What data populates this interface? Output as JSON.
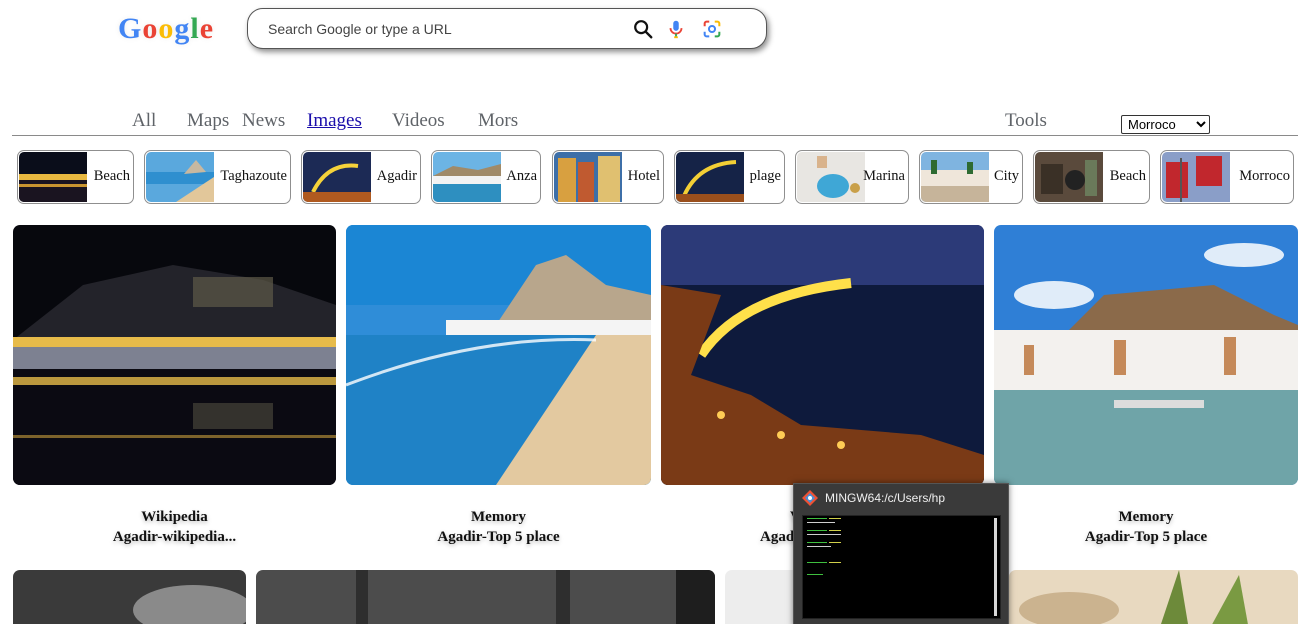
{
  "logo": {
    "letters": [
      "G",
      "o",
      "o",
      "g",
      "l",
      "e"
    ],
    "colors": [
      "#4285F4",
      "#EA4335",
      "#FBBC05",
      "#4285F4",
      "#34A853",
      "#EA4335"
    ]
  },
  "search": {
    "placeholder": "Search Google or type a URL",
    "value": "",
    "icons": [
      "search-icon",
      "microphone-icon",
      "lens-icon"
    ]
  },
  "tabs": [
    {
      "label": "All",
      "active": false
    },
    {
      "label": "Maps",
      "active": false
    },
    {
      "label": "News",
      "active": false
    },
    {
      "label": "Images",
      "active": true
    },
    {
      "label": "Videos",
      "active": false
    },
    {
      "label": "Mors",
      "active": false
    }
  ],
  "tools": {
    "label": "Tools"
  },
  "region": {
    "selected": "Morroco"
  },
  "chips": [
    {
      "label": "Beach"
    },
    {
      "label": "Taghazoute"
    },
    {
      "label": "Agadir"
    },
    {
      "label": "Anza"
    },
    {
      "label": "Hotel"
    },
    {
      "label": "plage"
    },
    {
      "label": "Marina"
    },
    {
      "label": "City"
    },
    {
      "label": "Beach"
    },
    {
      "label": "Morroco"
    }
  ],
  "results": [
    {
      "source": "Wikipedia",
      "title": "Agadir-wikipedia..."
    },
    {
      "source": "Memory",
      "title": "Agadir-Top 5 place"
    },
    {
      "source": "V",
      "title": "Agad"
    },
    {
      "source": "Memory",
      "title": "Agadir-Top 5 place"
    }
  ],
  "popup": {
    "title": "MINGW64:/c/Users/hp",
    "icon": "git-bash-icon"
  }
}
